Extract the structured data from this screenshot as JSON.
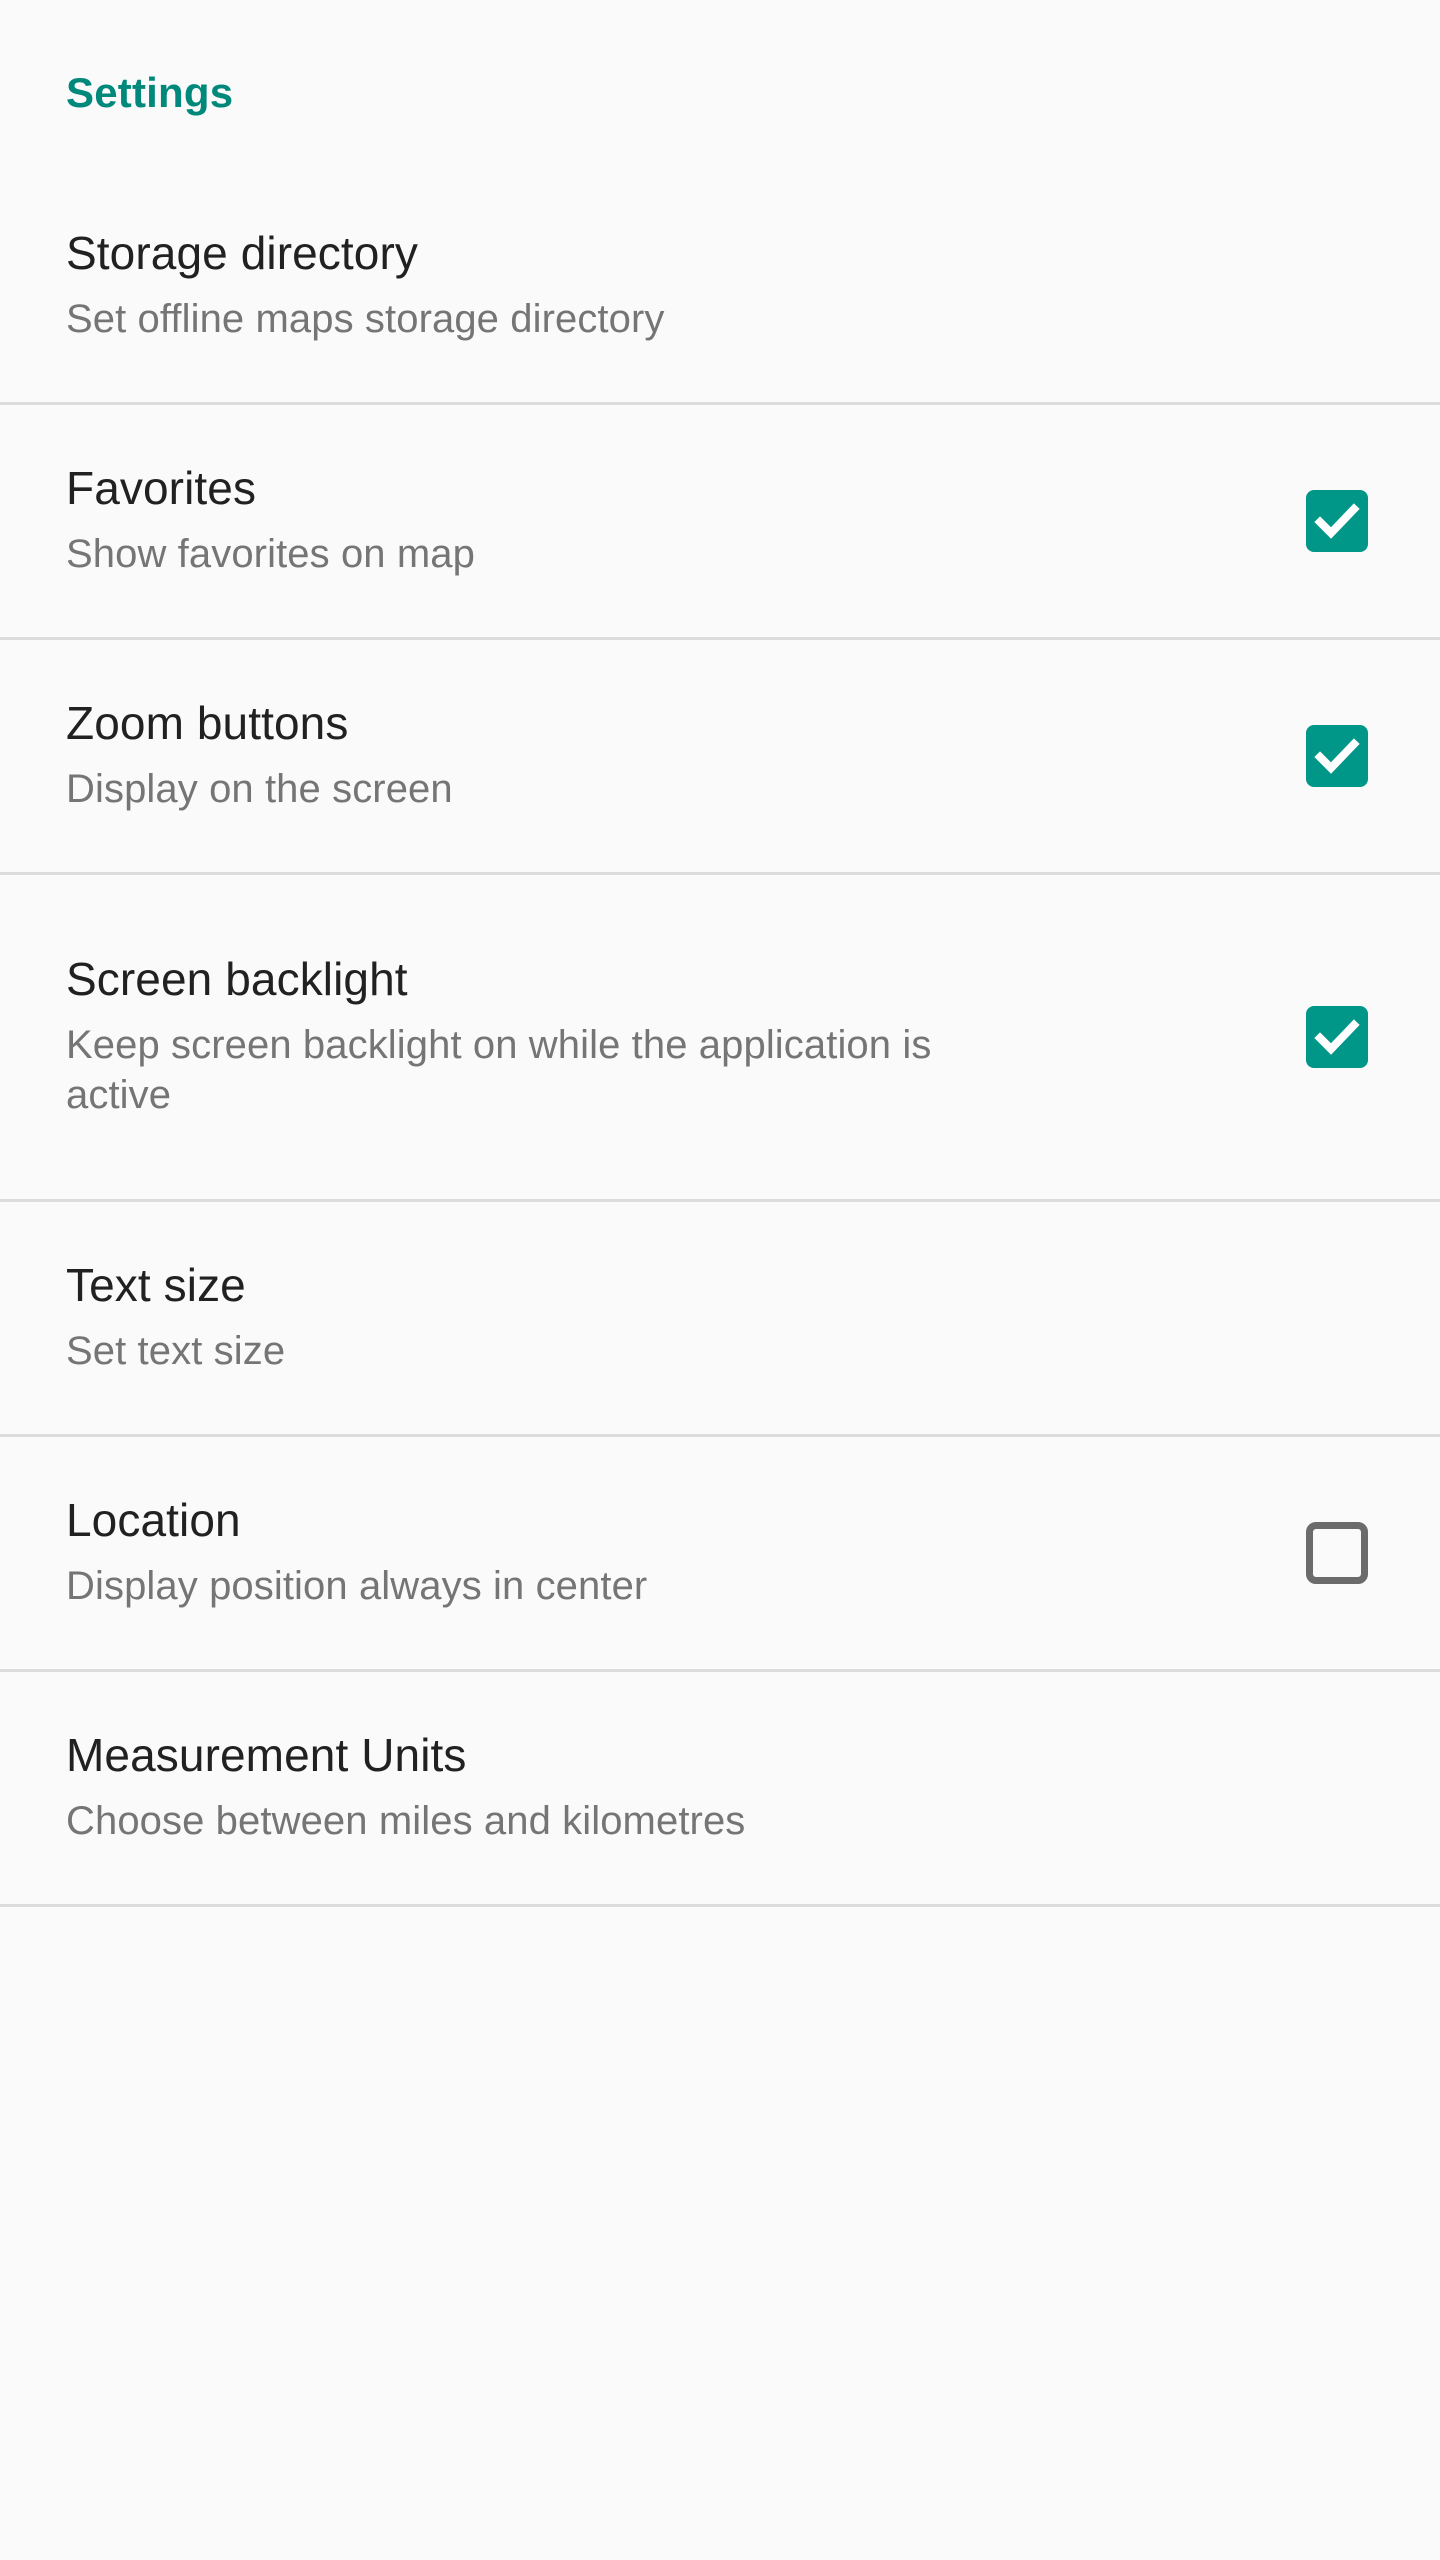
{
  "header": {
    "title": "Settings",
    "accent_color": "#00897b"
  },
  "theme": {
    "background": "#fafafa",
    "divider_color": "#dcdcdc",
    "title_color": "#212121",
    "summary_color": "#757575",
    "checkbox_checked_color": "#009688",
    "checkbox_unchecked_border_color": "#6b6b6b",
    "check_mark_color": "#ffffff"
  },
  "preferences": [
    {
      "title": "Storage directory",
      "summary": "Set offline maps storage directory",
      "widget": "none",
      "checked": null,
      "icon": null
    },
    {
      "title": "Favorites",
      "summary": "Show favorites on map",
      "widget": "checkbox",
      "checked": true,
      "icon": "checkbox-checked-icon"
    },
    {
      "title": "Zoom buttons",
      "summary": "Display on the screen",
      "widget": "checkbox",
      "checked": true,
      "icon": "checkbox-checked-icon"
    },
    {
      "title": "Screen backlight",
      "summary": "Keep screen backlight on while the application is active",
      "widget": "checkbox",
      "checked": true,
      "icon": "checkbox-checked-icon"
    },
    {
      "title": "Text size",
      "summary": "Set text size",
      "widget": "none",
      "checked": null,
      "icon": null
    },
    {
      "title": "Location",
      "summary": "Display position always in center",
      "widget": "checkbox",
      "checked": false,
      "icon": "checkbox-unchecked-icon"
    },
    {
      "title": "Measurement Units",
      "summary": "Choose between miles and kilometres",
      "widget": "none",
      "checked": null,
      "icon": null
    }
  ]
}
